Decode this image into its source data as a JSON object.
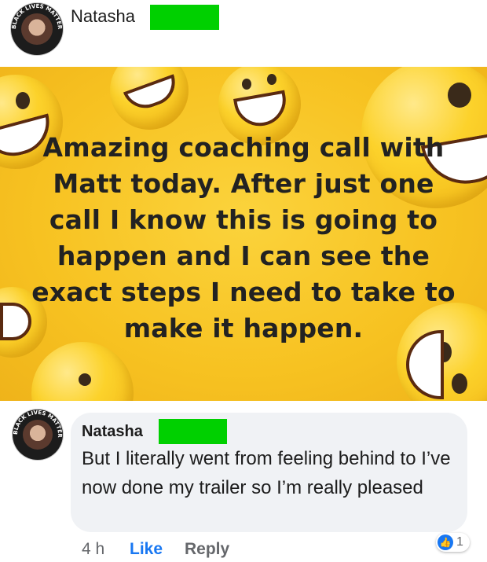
{
  "post": {
    "author": "Natasha",
    "avatar_badge_text": "BLACK LIVES MATTER",
    "banner_text": "Amazing coaching call with Matt today. After just one call I know this is going to happen and I can see the exact steps I need to take to make it happen."
  },
  "comment": {
    "author": "Natasha",
    "avatar_badge_text": "BLACK LIVES MATTER",
    "text": "But I literally went from feeling behind to I’ve now done my trailer so I’m really pleased",
    "time": "4 h",
    "like_label": "Like",
    "reply_label": "Reply",
    "reaction_count": "1",
    "reaction_icon": "like-thumb-icon"
  },
  "colors": {
    "redaction": "#00d000",
    "banner": "#f7c221",
    "link_blue": "#1877f2",
    "bubble": "#f0f2f5"
  }
}
